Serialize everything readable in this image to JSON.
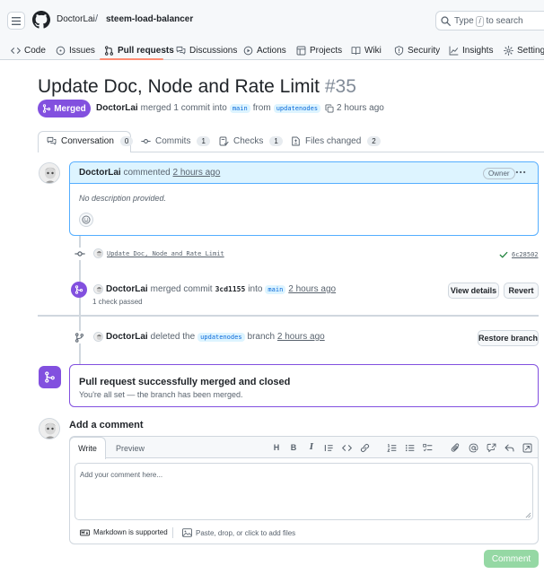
{
  "header": {
    "owner": "DoctorLai",
    "separator": "/",
    "repo": "steem-load-balancer",
    "search_prefix": "Type",
    "search_key": "/",
    "search_suffix": "to search"
  },
  "repo_tabs": [
    {
      "label": "Code",
      "icon": "code-icon"
    },
    {
      "label": "Issues",
      "icon": "issue-icon"
    },
    {
      "label": "Pull requests",
      "icon": "pull-request-icon"
    },
    {
      "label": "Discussions",
      "icon": "comment-discussion-icon"
    },
    {
      "label": "Actions",
      "icon": "play-icon"
    },
    {
      "label": "Projects",
      "icon": "table-icon"
    },
    {
      "label": "Wiki",
      "icon": "book-icon"
    },
    {
      "label": "Security",
      "icon": "shield-icon"
    },
    {
      "label": "Insights",
      "icon": "graph-icon"
    },
    {
      "label": "Settings",
      "icon": "gear-icon"
    }
  ],
  "pr": {
    "title": "Update Doc, Node and Rate Limit",
    "number": "#35",
    "state": "Merged",
    "author": "DoctorLai",
    "merged_text": "merged 1 commit into",
    "base_branch": "main",
    "from_text": "from",
    "head_branch": "updatenodes",
    "time": "2 hours ago"
  },
  "pr_tabs": [
    {
      "label": "Conversation",
      "count": "0",
      "icon": "comment-discussion-icon"
    },
    {
      "label": "Commits",
      "count": "1",
      "icon": "git-commit-icon"
    },
    {
      "label": "Checks",
      "count": "1",
      "icon": "checklist-icon"
    },
    {
      "label": "Files changed",
      "count": "2",
      "icon": "file-diff-icon"
    }
  ],
  "comment": {
    "author": "DoctorLai",
    "action": "commented",
    "time": "2 hours ago",
    "badge": "Owner",
    "body": "No description provided."
  },
  "timeline": {
    "commit_message": "Update Doc, Node and Rate Limit",
    "commit_sha": "6c28502",
    "merge_author": "DoctorLai",
    "merge_text": "merged commit",
    "merge_sha": "3cd1155",
    "merge_into": "into",
    "merge_branch": "main",
    "merge_time": "2 hours ago",
    "checks": "1 check passed",
    "view_details": "View details",
    "revert": "Revert",
    "delete_author": "DoctorLai",
    "delete_text": "deleted the",
    "delete_branch": "updatenodes",
    "delete_branch_word": "branch",
    "delete_time": "2 hours ago",
    "restore_branch": "Restore branch"
  },
  "merged_box": {
    "heading": "Pull request successfully merged and closed",
    "subtext": "You're all set — the branch has been merged."
  },
  "add_comment": {
    "heading": "Add a comment",
    "write_tab": "Write",
    "preview_tab": "Preview",
    "placeholder": "Add your comment here...",
    "markdown_note": "Markdown is supported",
    "attach_note": "Paste, drop, or click to add files",
    "submit": "Comment"
  },
  "colors": {
    "merged_purple": "#8250df",
    "accent_blue": "#0969da",
    "underline_orange": "#fd8c73",
    "success_green": "#1a7f37"
  }
}
